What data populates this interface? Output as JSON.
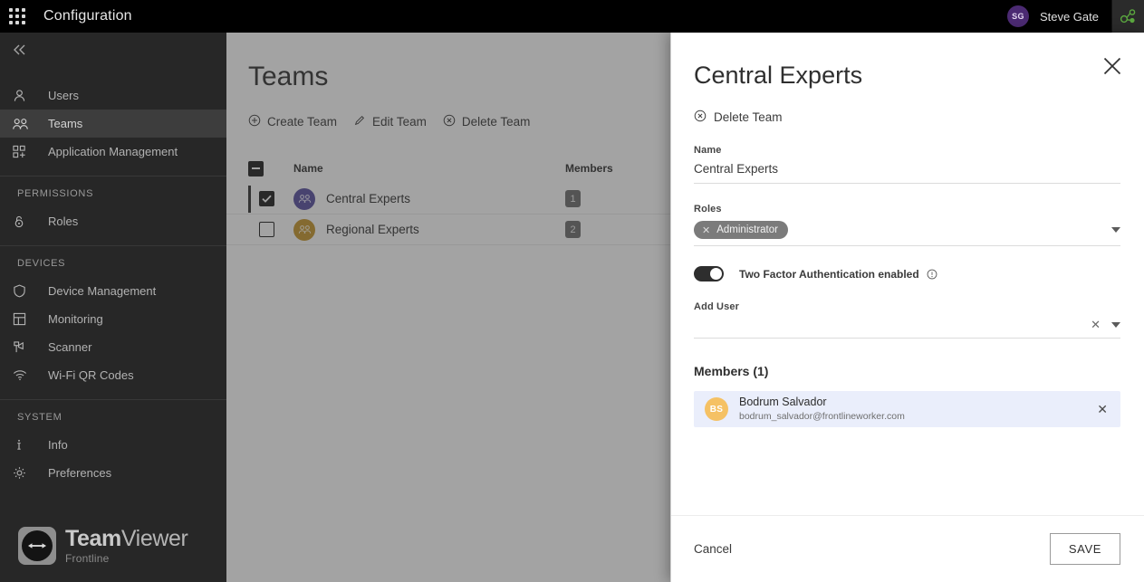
{
  "topbar": {
    "app_grid_icon": "apps-grid-icon",
    "title": "Configuration",
    "user_initials": "SG",
    "user_name": "Steve Gate",
    "connection_icon": "connection-status-icon",
    "accent_avatar_color": "#4b2a72",
    "connection_color": "#5ba83f"
  },
  "sidebar": {
    "collapse_icon": "chevron-double-left-icon",
    "items": [
      {
        "label": "Users",
        "icon": "user-icon",
        "active": false
      },
      {
        "label": "Teams",
        "icon": "users-group-icon",
        "active": true
      },
      {
        "label": "Application Management",
        "icon": "app-add-icon",
        "active": false
      }
    ],
    "groups": [
      {
        "title": "PERMISSIONS",
        "items": [
          {
            "label": "Roles",
            "icon": "lock-icon",
            "active": false
          }
        ]
      },
      {
        "title": "DEVICES",
        "items": [
          {
            "label": "Device Management",
            "icon": "shield-icon",
            "active": false
          },
          {
            "label": "Monitoring",
            "icon": "dashboard-grid-icon",
            "active": false
          },
          {
            "label": "Scanner",
            "icon": "barcode-scanner-icon",
            "active": false
          },
          {
            "label": "Wi-Fi QR Codes",
            "icon": "wifi-icon",
            "active": false
          }
        ]
      },
      {
        "title": "SYSTEM",
        "items": [
          {
            "label": "Info",
            "icon": "info-icon",
            "active": false
          },
          {
            "label": "Preferences",
            "icon": "gear-icon",
            "active": false
          }
        ]
      }
    ],
    "brand": {
      "name_bold": "Team",
      "name_light": "Viewer",
      "sub": "Frontline",
      "logo_icon": "teamviewer-logo-icon"
    }
  },
  "main": {
    "page_title": "Teams",
    "toolbar": [
      {
        "label": "Create Team",
        "icon": "plus-circle-icon"
      },
      {
        "label": "Edit Team",
        "icon": "pencil-icon"
      },
      {
        "label": "Delete Team",
        "icon": "x-circle-icon"
      }
    ],
    "table": {
      "header_checkbox_state": "indeterminate",
      "columns": [
        "Name",
        "Members"
      ],
      "rows": [
        {
          "name": "Central Experts",
          "members": "1",
          "checked": true,
          "selected": true,
          "avatar_color": "#5a51a0",
          "avatar_icon": "team-avatar-icon"
        },
        {
          "name": "Regional Experts",
          "members": "2",
          "checked": false,
          "selected": false,
          "avatar_color": "#c6982f",
          "avatar_icon": "team-avatar-icon"
        }
      ]
    }
  },
  "panel": {
    "title": "Central Experts",
    "close_icon": "close-icon",
    "delete_action": {
      "label": "Delete Team",
      "icon": "x-circle-icon"
    },
    "name_field": {
      "label": "Name",
      "value": "Central Experts"
    },
    "roles_field": {
      "label": "Roles",
      "chips": [
        {
          "label": "Administrator",
          "remove_icon": "chip-remove-icon"
        }
      ],
      "caret_icon": "chevron-down-icon"
    },
    "two_factor": {
      "label": "Two Factor Authentication enabled",
      "enabled": true,
      "info_icon": "info-circle-icon"
    },
    "add_user_field": {
      "label": "Add User",
      "value": "",
      "placeholder": "",
      "clear_icon": "clear-icon",
      "caret_icon": "chevron-down-icon"
    },
    "members_heading": "Members (1)",
    "members": [
      {
        "initials": "BS",
        "name": "Bodrum Salvador",
        "email": "bodrum_salvador@frontlineworker.com",
        "avatar_color": "#f5c164",
        "remove_icon": "remove-member-icon"
      }
    ],
    "footer": {
      "cancel_label": "Cancel",
      "save_label": "SAVE"
    }
  }
}
